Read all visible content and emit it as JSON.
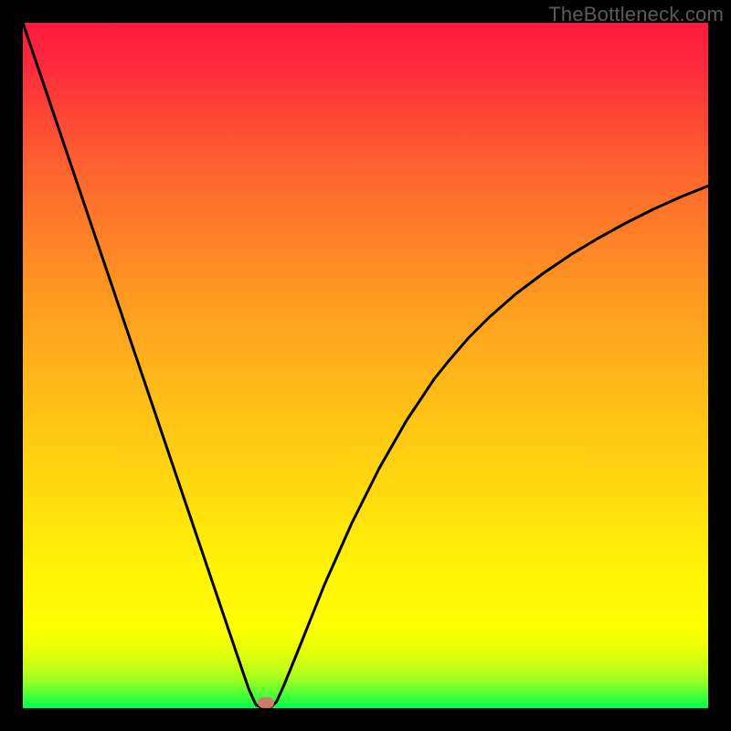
{
  "watermark": "TheBottleneck.com",
  "chart_data": {
    "type": "line",
    "title": "",
    "xlabel": "",
    "ylabel": "",
    "xlim": [
      0,
      100
    ],
    "ylim": [
      0,
      100
    ],
    "grid": false,
    "legend": false,
    "series": [
      {
        "name": "bottleneck-curve",
        "x": [
          0,
          2,
          4,
          6,
          8,
          10,
          12,
          14,
          16,
          18,
          20,
          22,
          24,
          26,
          28,
          30,
          32,
          33,
          34,
          35,
          36,
          37,
          38,
          40,
          42,
          44,
          46,
          48,
          50,
          52,
          54,
          56,
          58,
          60,
          62,
          65,
          68,
          72,
          76,
          80,
          84,
          88,
          92,
          96,
          100
        ],
        "y": [
          100,
          94.1,
          88.2,
          82.3,
          76.4,
          70.5,
          64.6,
          58.7,
          52.8,
          46.9,
          41.0,
          35.1,
          29.2,
          23.3,
          17.4,
          11.5,
          5.6,
          2.7,
          0.5,
          0.0,
          0.0,
          0.9,
          3.1,
          8.0,
          13.0,
          18.0,
          22.5,
          27.0,
          31.0,
          35.0,
          38.5,
          42.0,
          45.0,
          48.0,
          50.5,
          54.0,
          57.0,
          60.5,
          63.5,
          66.2,
          68.6,
          70.8,
          72.8,
          74.6,
          76.2
        ]
      }
    ],
    "marker": {
      "x": 35.5,
      "y": 0.8
    },
    "background": {
      "type": "vertical-gradient",
      "stops": [
        {
          "pos": 0,
          "color": "#fd1a3f"
        },
        {
          "pos": 50,
          "color": "#feb01b"
        },
        {
          "pos": 85,
          "color": "#fffb03"
        },
        {
          "pos": 100,
          "color": "#00ff4c"
        }
      ]
    }
  }
}
